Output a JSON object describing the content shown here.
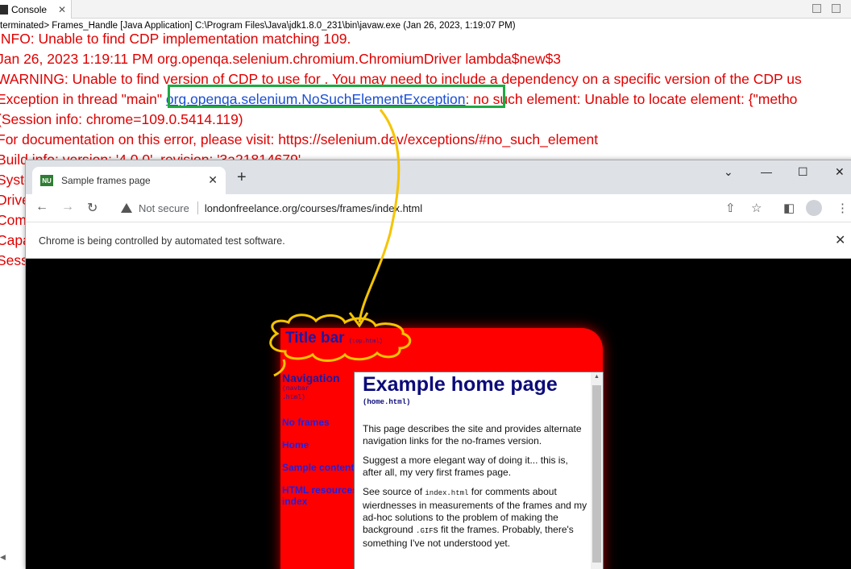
{
  "console": {
    "tab_label": "Console",
    "tab_close": "✕",
    "status": "terminated> Frames_Handle [Java Application] C:\\Program Files\\Java\\jdk1.8.0_231\\bin\\javaw.exe (Jan 26, 2023, 1:19:07 PM)",
    "lines": [
      "INFO: Unable to find CDP implementation matching 109.",
      "Jan 26, 2023 1:19:11 PM org.openqa.selenium.chromium.ChromiumDriver lambda$new$3",
      "WARNING: Unable to find version of CDP to use for . You may need to include a dependency on a specific version of the CDP us",
      "",
      " (Session info: chrome=109.0.5414.119)",
      "For documentation on this error, please visit: https://selenium.dev/exceptions/#no_such_element",
      "Build info: version: '4.0.0', revision: '3a21814679'",
      "System",
      "Driver",
      "Com",
      "Capa",
      "Sess"
    ],
    "exception_prefix": "Exception in thread \"main\" ",
    "exception_link": "org.openqa.selenium.NoSuchElementException",
    "exception_suffix": ": no such element: Unable to locate element: {\"metho"
  },
  "chrome": {
    "tab_title": "Sample frames page",
    "favicon_text": "NU",
    "tab_close": "✕",
    "new_tab": "+",
    "minimize": "—",
    "maximize": "☐",
    "close": "✕",
    "chevron": "⌄",
    "not_secure": "Not secure",
    "url": "londonfreelance.org/courses/frames/index.html",
    "infobar_text": "Chrome is being controlled by automated test software.",
    "infobar_close": "✕"
  },
  "page": {
    "title_bar": "Title bar",
    "title_bar_file": "(top.html)",
    "nav_heading": "Navigation",
    "nav_file_1": "(navbar",
    "nav_file_2": ".html)",
    "nav_links": [
      "No frames",
      "Home",
      "Sample content",
      "HTML resources index"
    ],
    "home_heading": "Example home page",
    "home_file": "(home.html)",
    "p1": "This page describes the site and provides alternate navigation links for the no-frames version.",
    "p2": "Suggest a more elegant way of doing it... this is, after all, my very first frames page.",
    "p3_a": "See source of ",
    "p3_code": "index.html",
    "p3_b": " for comments about wierdnesses in measurements of the frames and my ad-hoc solutions to the problem of making the background ",
    "p3_code2": ".GIF",
    "p3_c": "s fit the frames. Probably, there's something I've not understood yet."
  },
  "colors": {
    "error_text": "#e00000",
    "highlight_box": "#1fa843",
    "annotation": "#f5c400",
    "frame_red": "#ff0000"
  }
}
